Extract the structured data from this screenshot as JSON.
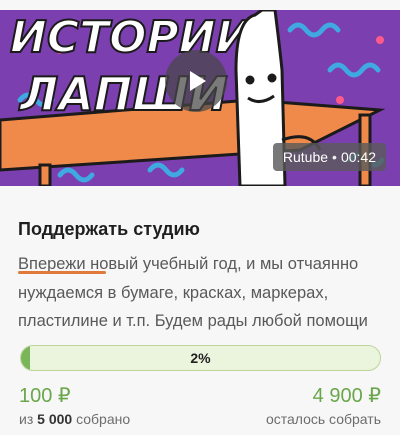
{
  "video": {
    "source": "Rutube",
    "separator": "•",
    "duration": "00:42",
    "poster_text_top": "ИСТОРИИ",
    "poster_text_bottom": "ЛАПШИ",
    "colors": {
      "background": "#7b3fb0",
      "table": "#f08a4b",
      "squiggle": "#3fa9e0"
    }
  },
  "donation": {
    "title": "Поддержать студию",
    "description_lines": [
      "Впережи новый учебный год, и мы отчаянно",
      "нуждаемся в бумаге, красках, маркерах,",
      "пластилине и т.п. Будем рады любой помощи"
    ],
    "progress_label": "2%",
    "progress_fraction": 0.02,
    "collected_amount": "100 ₽",
    "remaining_amount": "4 900 ₽",
    "goal_prefix": "из",
    "goal_value": "5 000",
    "goal_suffix": "собрано",
    "remaining_label": "осталось собрать",
    "colors": {
      "accent": "#6aa74a",
      "bar_fill": "#7ab55a",
      "underline": "#e07a3a"
    }
  }
}
